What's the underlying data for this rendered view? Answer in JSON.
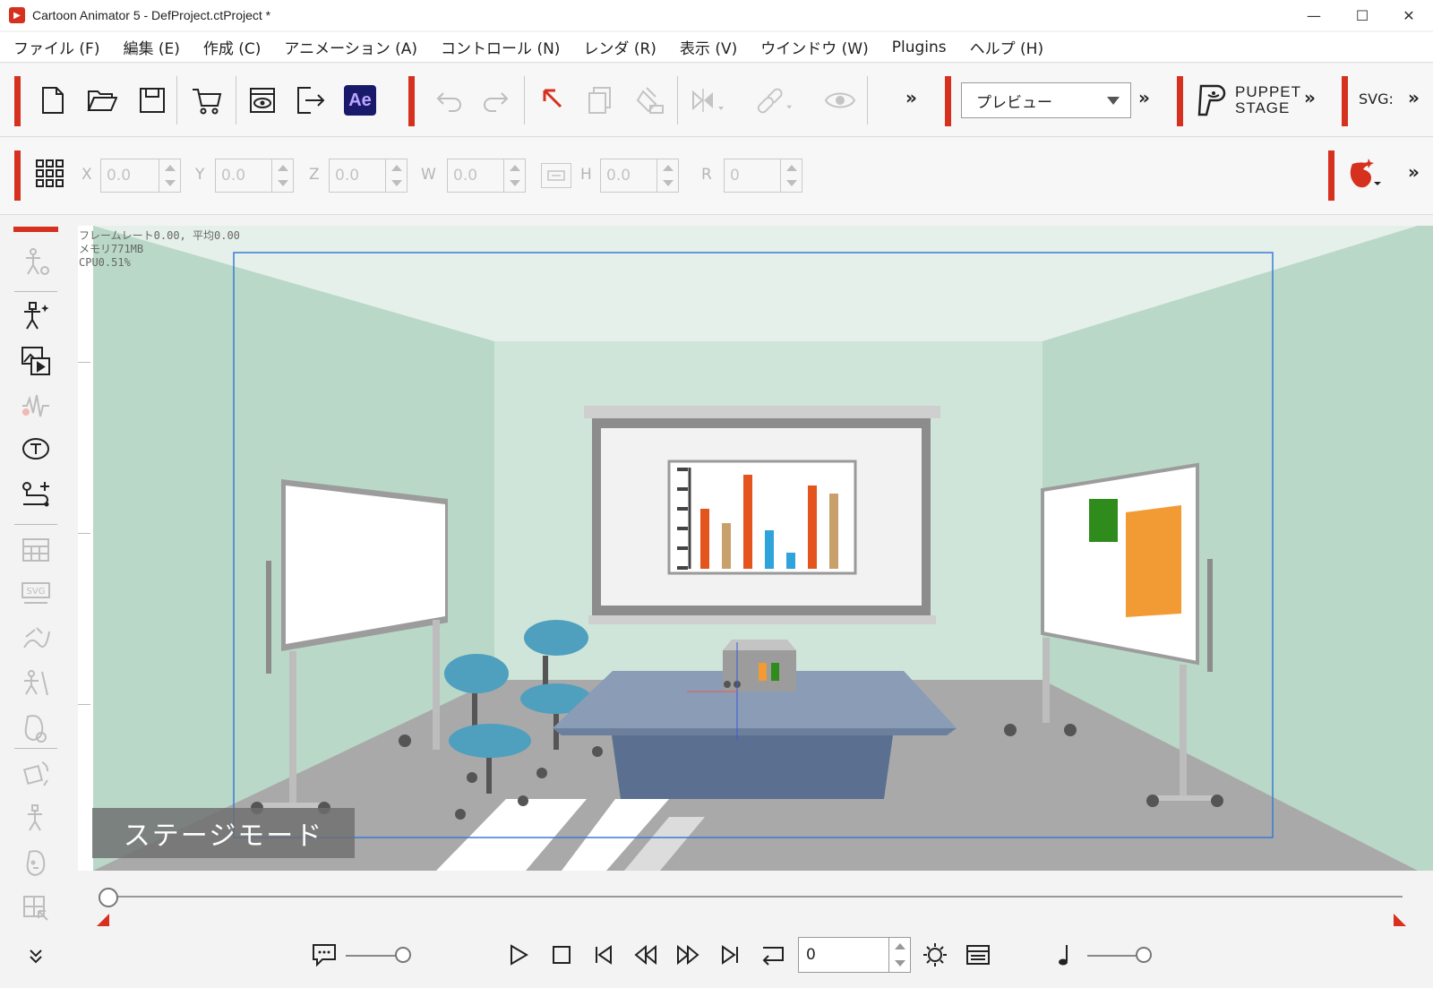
{
  "window": {
    "title": "Cartoon Animator 5 - DefProject.ctProject *",
    "controls": [
      "minimize",
      "maximize",
      "close"
    ]
  },
  "menu": [
    "ファイル (F)",
    "編集 (E)",
    "作成 (C)",
    "アニメーション (A)",
    "コントロール (N)",
    "レンダ (R)",
    "表示 (V)",
    "ウインドウ (W)",
    "Plugins",
    "ヘルプ (H)"
  ],
  "toolbar": {
    "ae_label": "Ae",
    "preview_select": "プレビュー",
    "puppet_line1": "PUPPET",
    "puppet_line2": "STAGE",
    "svg_label": "SVG:",
    "more": "»"
  },
  "transform": {
    "x_label": "X",
    "x_value": "0.0",
    "y_label": "Y",
    "y_value": "0.0",
    "z_label": "Z",
    "z_value": "0.0",
    "w_label": "W",
    "w_value": "0.0",
    "h_label": "H",
    "h_value": "0.0",
    "r_label": "R",
    "r_value": "0"
  },
  "stage": {
    "stats_fps": "フレームレート0.00, 平均0.00",
    "stats_mem": "メモリ771MB",
    "stats_cpu": "CPU0.51%",
    "mode_label": "ステージモード"
  },
  "playback": {
    "frame_value": "0"
  },
  "colors": {
    "accent": "#d6301f",
    "wall_light": "#cfe5d9",
    "wall_side": "#b9d8c7",
    "floor": "#a9a9a9",
    "table": "#5b7090",
    "chair": "#4f9fbe",
    "camera_frame": "#3a7bd5"
  }
}
